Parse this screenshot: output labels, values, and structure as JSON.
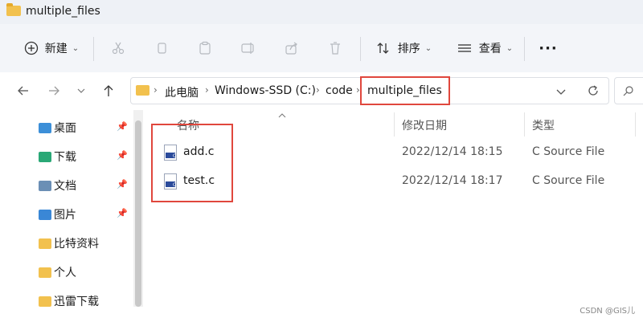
{
  "window": {
    "title": "multiple_files"
  },
  "toolbar": {
    "new_label": "新建",
    "sort_label": "排序",
    "view_label": "查看",
    "more_label": "···",
    "caret": "⌄"
  },
  "address": {
    "crumbs": [
      "此电脑",
      "Windows-SSD (C:)",
      "code",
      "multiple_files"
    ],
    "separator": "›"
  },
  "sidebar": {
    "items": [
      {
        "label": "桌面",
        "icon": "desktop-icon",
        "color": "#3c8fd8",
        "pinned": true
      },
      {
        "label": "下载",
        "icon": "download-icon",
        "color": "#2aa876",
        "pinned": true
      },
      {
        "label": "文档",
        "icon": "documents-icon",
        "color": "#6b8fb5",
        "pinned": true
      },
      {
        "label": "图片",
        "icon": "pictures-icon",
        "color": "#3a87d6",
        "pinned": true
      },
      {
        "label": "比特资料",
        "icon": "folder-icon",
        "color": "#f2c14e",
        "pinned": false
      },
      {
        "label": "个人",
        "icon": "folder-icon",
        "color": "#f2c14e",
        "pinned": false
      },
      {
        "label": "迅雷下载",
        "icon": "folder-icon",
        "color": "#f2c14e",
        "pinned": false
      }
    ]
  },
  "columns": {
    "name": "名称",
    "date": "修改日期",
    "type": "类型"
  },
  "files": [
    {
      "name": "add.c",
      "date": "2022/12/14 18:15",
      "type": "C Source File"
    },
    {
      "name": "test.c",
      "date": "2022/12/14 18:17",
      "type": "C Source File"
    }
  ],
  "watermark": "CSDN @GIS儿",
  "colors": {
    "highlight": "#e0473d",
    "folder": "#f2c14e"
  }
}
